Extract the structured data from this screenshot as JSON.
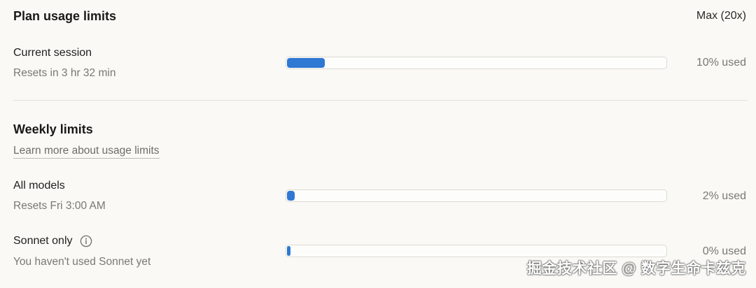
{
  "header": {
    "title": "Plan usage limits",
    "plan": "Max (20x)"
  },
  "current_session": {
    "label": "Current session",
    "subtitle": "Resets in 3 hr 32 min",
    "usage_fraction": 0.1,
    "usage_text": "10% used"
  },
  "weekly": {
    "title": "Weekly limits",
    "link": "Learn more about usage limits",
    "rows": [
      {
        "label": "All models",
        "subtitle": "Resets Fri 3:00 AM",
        "usage_fraction": 0.02,
        "usage_text": "2% used"
      },
      {
        "label": "Sonnet only",
        "subtitle": "You haven't used Sonnet yet",
        "usage_fraction": 0.0,
        "usage_text": "0% used"
      }
    ]
  },
  "watermark": "掘金技术社区 @ 数字生命卡兹克",
  "colors": {
    "bar_fill": "#2f78d3",
    "background": "#faf9f5"
  },
  "icons": {
    "sonnet_info": "info-icon"
  }
}
